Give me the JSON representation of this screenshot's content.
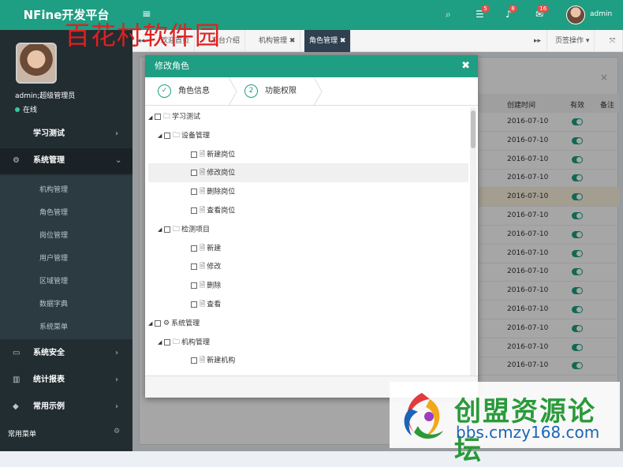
{
  "brand": "NFine开发平台",
  "topbar": {
    "badges": [
      "5",
      "8",
      "16"
    ],
    "user": "admin"
  },
  "watermark": "百花村软件园",
  "sidebar": {
    "user_name": "admin;超级管理员",
    "status": "在线",
    "items": [
      {
        "label": "学习测试",
        "chev": "›"
      },
      {
        "label": "系统管理",
        "chev": "⌄"
      },
      {
        "label": "系统安全",
        "chev": "›"
      },
      {
        "label": "统计报表",
        "chev": "›"
      },
      {
        "label": "常用示例",
        "chev": "›"
      }
    ],
    "sub_items": [
      "机构管理",
      "角色管理",
      "岗位管理",
      "用户管理",
      "区域管理",
      "数据字典",
      "系统菜单"
    ],
    "footer": "常用菜单"
  },
  "tabs": {
    "items": [
      "欢迎首页",
      "平台介绍",
      "机构管理 ✖",
      "角色管理 ✖"
    ],
    "page_ops": "页签操作 ▾"
  },
  "grid": {
    "headers": [
      "创建时间",
      "有效",
      "备注"
    ],
    "dates": [
      "2016-07-10",
      "2016-07-10",
      "2016-07-10",
      "2016-07-10",
      "2016-07-10",
      "2016-07-10",
      "2016-07-10",
      "2016-07-10",
      "2016-07-10",
      "2016-07-10",
      "2016-07-10",
      "2016-07-10",
      "2016-07-10",
      "2016-07-10"
    ]
  },
  "dialog": {
    "title": "修改角色",
    "steps": [
      {
        "num": "✓",
        "label": "角色信息"
      },
      {
        "num": "2",
        "label": "功能权限"
      }
    ],
    "tree": [
      {
        "label": "学习测试",
        "depth": 0,
        "icon": "folder"
      },
      {
        "label": "设备管理",
        "depth": 1,
        "icon": "folder"
      },
      {
        "label": "新建岗位",
        "depth": 2,
        "icon": "file"
      },
      {
        "label": "修改岗位",
        "depth": 2,
        "icon": "file"
      },
      {
        "label": "删除岗位",
        "depth": 2,
        "icon": "file"
      },
      {
        "label": "查看岗位",
        "depth": 2,
        "icon": "file"
      },
      {
        "label": "检测项目",
        "depth": 1,
        "icon": "folder"
      },
      {
        "label": "新建",
        "depth": 2,
        "icon": "file"
      },
      {
        "label": "修改",
        "depth": 2,
        "icon": "file"
      },
      {
        "label": "删除",
        "depth": 2,
        "icon": "file"
      },
      {
        "label": "查看",
        "depth": 2,
        "icon": "file"
      },
      {
        "label": "系统管理",
        "depth": 0,
        "icon": "gears"
      },
      {
        "label": "机构管理",
        "depth": 1,
        "icon": "folder"
      },
      {
        "label": "新建机构",
        "depth": 2,
        "icon": "file"
      }
    ]
  },
  "logo": {
    "text": "创盟资源论坛",
    "url": "bbs.cmzy168.com"
  }
}
